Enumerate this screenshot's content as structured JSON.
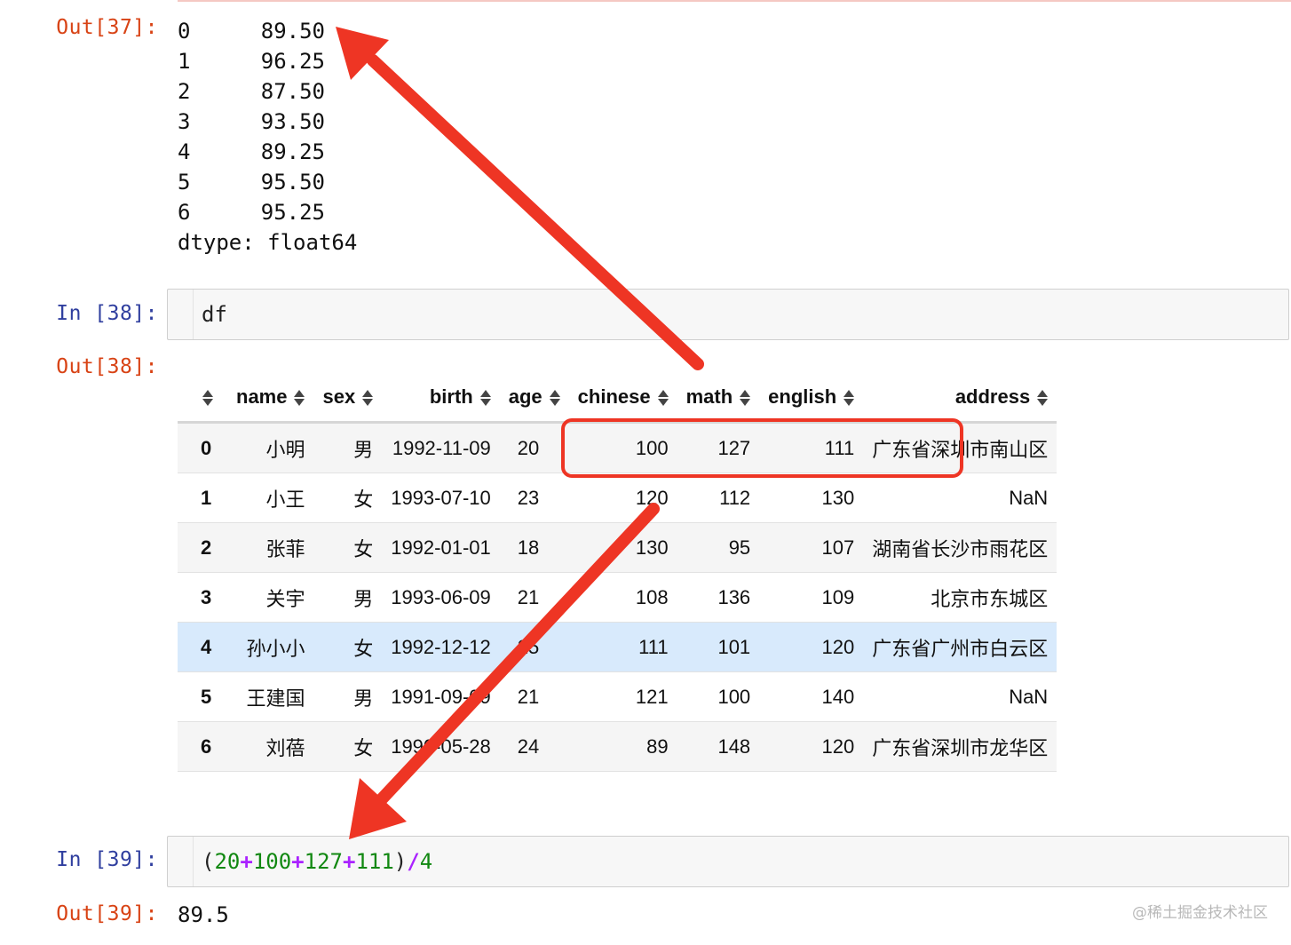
{
  "cells": {
    "out37": {
      "prompt": "Out[37]:",
      "series": [
        {
          "index": "0",
          "value": "89.50"
        },
        {
          "index": "1",
          "value": "96.25"
        },
        {
          "index": "2",
          "value": "87.50"
        },
        {
          "index": "3",
          "value": "93.50"
        },
        {
          "index": "4",
          "value": "89.25"
        },
        {
          "index": "5",
          "value": "95.50"
        },
        {
          "index": "6",
          "value": "95.25"
        }
      ],
      "dtype": "dtype: float64"
    },
    "in38": {
      "prompt": "In [38]:",
      "code": "df"
    },
    "out38": {
      "prompt": "Out[38]:"
    },
    "in39": {
      "prompt": "In [39]:",
      "code_tokens": [
        "(",
        "20",
        "+",
        "100",
        "+",
        "127",
        "+",
        "111",
        ")",
        "/",
        "4"
      ]
    },
    "out39": {
      "prompt": "Out[39]:",
      "result": "89.5"
    }
  },
  "dataframe": {
    "columns": [
      "name",
      "sex",
      "birth",
      "age",
      "chinese",
      "math",
      "english",
      "address"
    ],
    "rows": [
      {
        "index": "0",
        "name": "小明",
        "sex": "男",
        "birth": "1992-11-09",
        "age": "20",
        "chinese": "100",
        "math": "127",
        "english": "111",
        "address": "广东省深圳市南山区"
      },
      {
        "index": "1",
        "name": "小王",
        "sex": "女",
        "birth": "1993-07-10",
        "age": "23",
        "chinese": "120",
        "math": "112",
        "english": "130",
        "address": "NaN"
      },
      {
        "index": "2",
        "name": "张菲",
        "sex": "女",
        "birth": "1992-01-01",
        "age": "18",
        "chinese": "130",
        "math": "95",
        "english": "107",
        "address": "湖南省长沙市雨花区"
      },
      {
        "index": "3",
        "name": "关宇",
        "sex": "男",
        "birth": "1993-06-09",
        "age": "21",
        "chinese": "108",
        "math": "136",
        "english": "109",
        "address": "北京市东城区"
      },
      {
        "index": "4",
        "name": "孙小小",
        "sex": "女",
        "birth": "1992-12-12",
        "age": "25",
        "chinese": "111",
        "math": "101",
        "english": "120",
        "address": "广东省广州市白云区"
      },
      {
        "index": "5",
        "name": "王建国",
        "sex": "男",
        "birth": "1991-09-09",
        "age": "21",
        "chinese": "121",
        "math": "100",
        "english": "140",
        "address": "NaN"
      },
      {
        "index": "6",
        "name": "刘蓓",
        "sex": "女",
        "birth": "1990-05-28",
        "age": "24",
        "chinese": "89",
        "math": "148",
        "english": "120",
        "address": "广东省深圳市龙华区"
      }
    ],
    "highlighted_row": "4"
  },
  "annotations": {
    "color": "#ee3524",
    "highlight_box": "row 0: age, chinese, math, english"
  },
  "watermark": "@稀土掘金技术社区"
}
